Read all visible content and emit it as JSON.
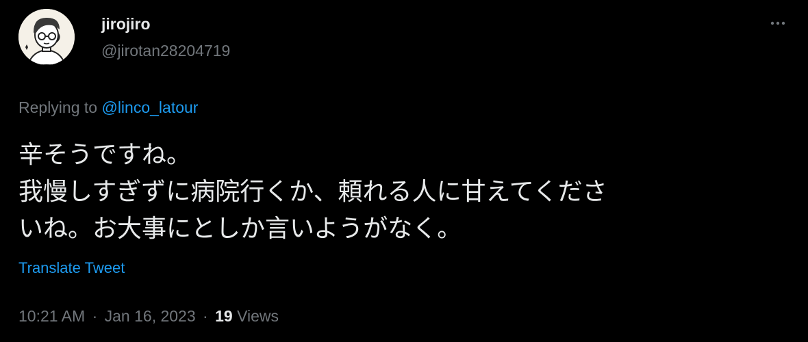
{
  "author": {
    "display_name": "jirojiro",
    "handle": "@jirotan28204719",
    "avatar_icon": "cartoon-man-with-glasses-avatar"
  },
  "more_icon": "ellipsis-icon",
  "reply_context": {
    "prefix": "Replying to ",
    "mention": "@linco_latour"
  },
  "text_lines": [
    "辛そうですね。",
    "我慢しすぎずに病院行くか、頼れる人に甘えてくださ",
    "いね。お大事にとしか言いようがなく。"
  ],
  "translate_label": "Translate Tweet",
  "meta": {
    "time": "10:21 AM",
    "separator": "·",
    "date": "Jan 16, 2023",
    "views_count": "19",
    "views_label": "Views"
  },
  "colors": {
    "background": "#000000",
    "primary_text": "#e7e9ea",
    "secondary_text": "#71767b",
    "link": "#1d9bf0"
  }
}
